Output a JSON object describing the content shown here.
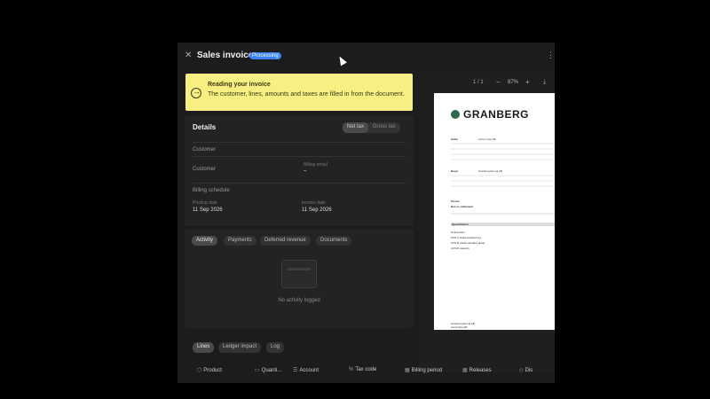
{
  "window": {
    "title": "Sales invoice",
    "status": "Processing",
    "close_icon": "close-icon",
    "menu_icon": "more-vertical-icon"
  },
  "banner": {
    "icon": "arrow-right-circle-icon",
    "title": "Reading your invoice",
    "text": "The customer, lines, amounts and taxes are filled in from the document.",
    "color": "#f7ef81"
  },
  "details": {
    "title": "Details",
    "toggle": [
      "Net tax",
      "Gross tax"
    ],
    "section_customer": "Customer",
    "customer_label": "Customer",
    "billing_email_label": "Billing email",
    "billing_email_value": "–",
    "section_schedule": "Billing schedule",
    "posting_date_label": "Posting date",
    "posting_date": "11 Sep 2026",
    "invoice_date_label": "Invoice date",
    "invoice_date": "11 Sep 2026"
  },
  "activity": {
    "tabs": [
      "Activity",
      "Payments",
      "Deferred revenue",
      "Documents"
    ],
    "empty_text": "No activity logged"
  },
  "preview": {
    "page": "1 / 1",
    "zoom": "87%",
    "minus": "−",
    "plus": "+",
    "download_icon": "download-icon",
    "logo": "GRANBERG",
    "period_label": "Period",
    "due_label": "Due to settlement",
    "seller_label": "Seller",
    "buyer_label": "Buyer",
    "seller_name": "Acme Corp AB",
    "buyer_name": "Granberg Energi AB",
    "spec_label": "Specification",
    "spec_rows": [
      "Deliveration",
      "PCR A rattila-standard ga",
      "PCR B rattila-standard gbate",
      "mPGR capacity"
    ],
    "footer_1": "Granberg Energi AB",
    "footer_2": "Kortstudio AB"
  },
  "lines": {
    "tabs": [
      "Lines",
      "Ledger impact",
      "Log"
    ],
    "columns": [
      "Product",
      "Quanti...",
      "Account",
      "Tax code",
      "Billing period",
      "Releases",
      "Dis"
    ]
  }
}
